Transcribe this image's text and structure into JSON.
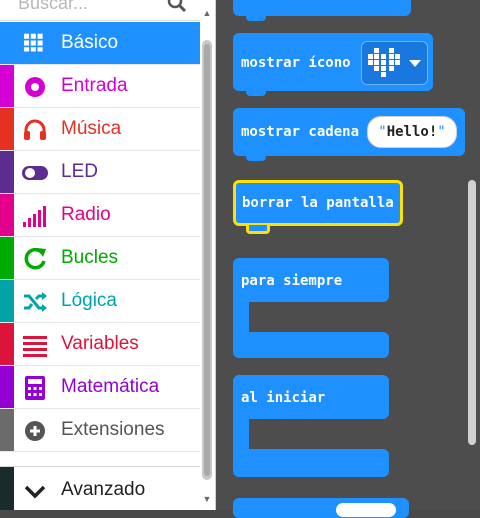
{
  "search": {
    "placeholder": "Buscar..."
  },
  "toolbox": {
    "items": [
      {
        "label": "Básico",
        "color": "#1e90ff",
        "icon": "grid-icon",
        "selected": true
      },
      {
        "label": "Entrada",
        "color": "#d400d4",
        "icon": "radio-circle-icon"
      },
      {
        "label": "Música",
        "color": "#e63022",
        "icon": "headphones-icon"
      },
      {
        "label": "LED",
        "color": "#5c2d91",
        "icon": "toggle-icon"
      },
      {
        "label": "Radio",
        "color": "#e3008c",
        "icon": "signal-bars-icon"
      },
      {
        "label": "Bucles",
        "color": "#00aa00",
        "icon": "refresh-icon"
      },
      {
        "label": "Lógica",
        "color": "#00a4a6",
        "icon": "shuffle-icon"
      },
      {
        "label": "Variables",
        "color": "#dc143c",
        "icon": "list-icon"
      },
      {
        "label": "Matemática",
        "color": "#9400d3",
        "icon": "calculator-icon"
      },
      {
        "label": "Extensiones",
        "color": "#6b6b6b",
        "icon": "plus-circle-icon"
      }
    ],
    "advanced": {
      "label": "Avanzado",
      "color": "#1a2b2b",
      "icon": "chevron-down-icon"
    }
  },
  "workspace": {
    "blocks": {
      "show_icon": "mostrar ícono",
      "show_string": "mostrar cadena",
      "string_value": "Hello!",
      "clear_screen": "borrar la pantalla",
      "forever": "para siempre",
      "on_start": "al iniciar"
    },
    "block_color": "#1e90ff",
    "highlight_color": "#ffe000"
  }
}
